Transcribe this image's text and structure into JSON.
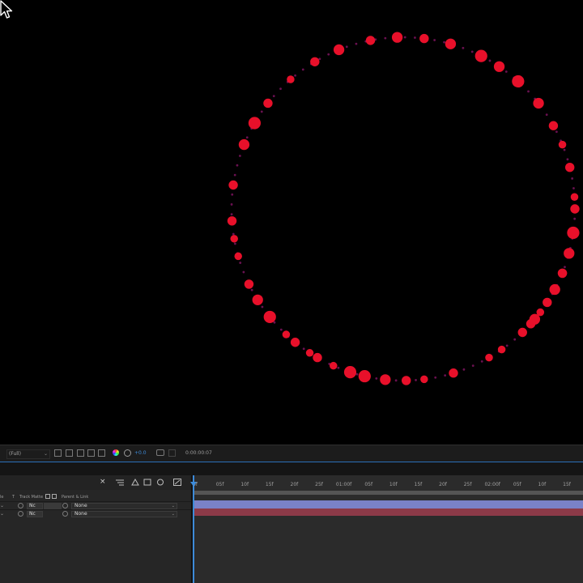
{
  "composition_viewer": {
    "background": "#000000",
    "dot_color": "#e8102a",
    "small_dot_color": "#6a1050",
    "cursor_icon": "arrow-pointer"
  },
  "viewer_toolbar": {
    "resolution": "(Full)",
    "exposure_value": "+0.0",
    "timecode": "0:00:00:07",
    "accent": "#2a6fb8",
    "exposure_color": "#3d8bd9"
  },
  "timeline": {
    "close_glyph": "×",
    "columns": {
      "mode_partial": "le",
      "t_label": "T",
      "track_matte": "Track Matte",
      "parent_link": "Parent & Link"
    },
    "layers": [
      {
        "matte": "Nc",
        "parent": "None",
        "bar_color": "#7a82c8"
      },
      {
        "matte": "Nc",
        "parent": "None",
        "bar_color": "#8c3a48"
      }
    ],
    "ruler_labels": [
      "0f",
      "05f",
      "10f",
      "15f",
      "20f",
      "25f",
      "01:00f",
      "05f",
      "10f",
      "15f",
      "20f",
      "25f",
      "02:00f",
      "05f",
      "10f",
      "15f"
    ],
    "cti_color": "#3d8bd9"
  }
}
